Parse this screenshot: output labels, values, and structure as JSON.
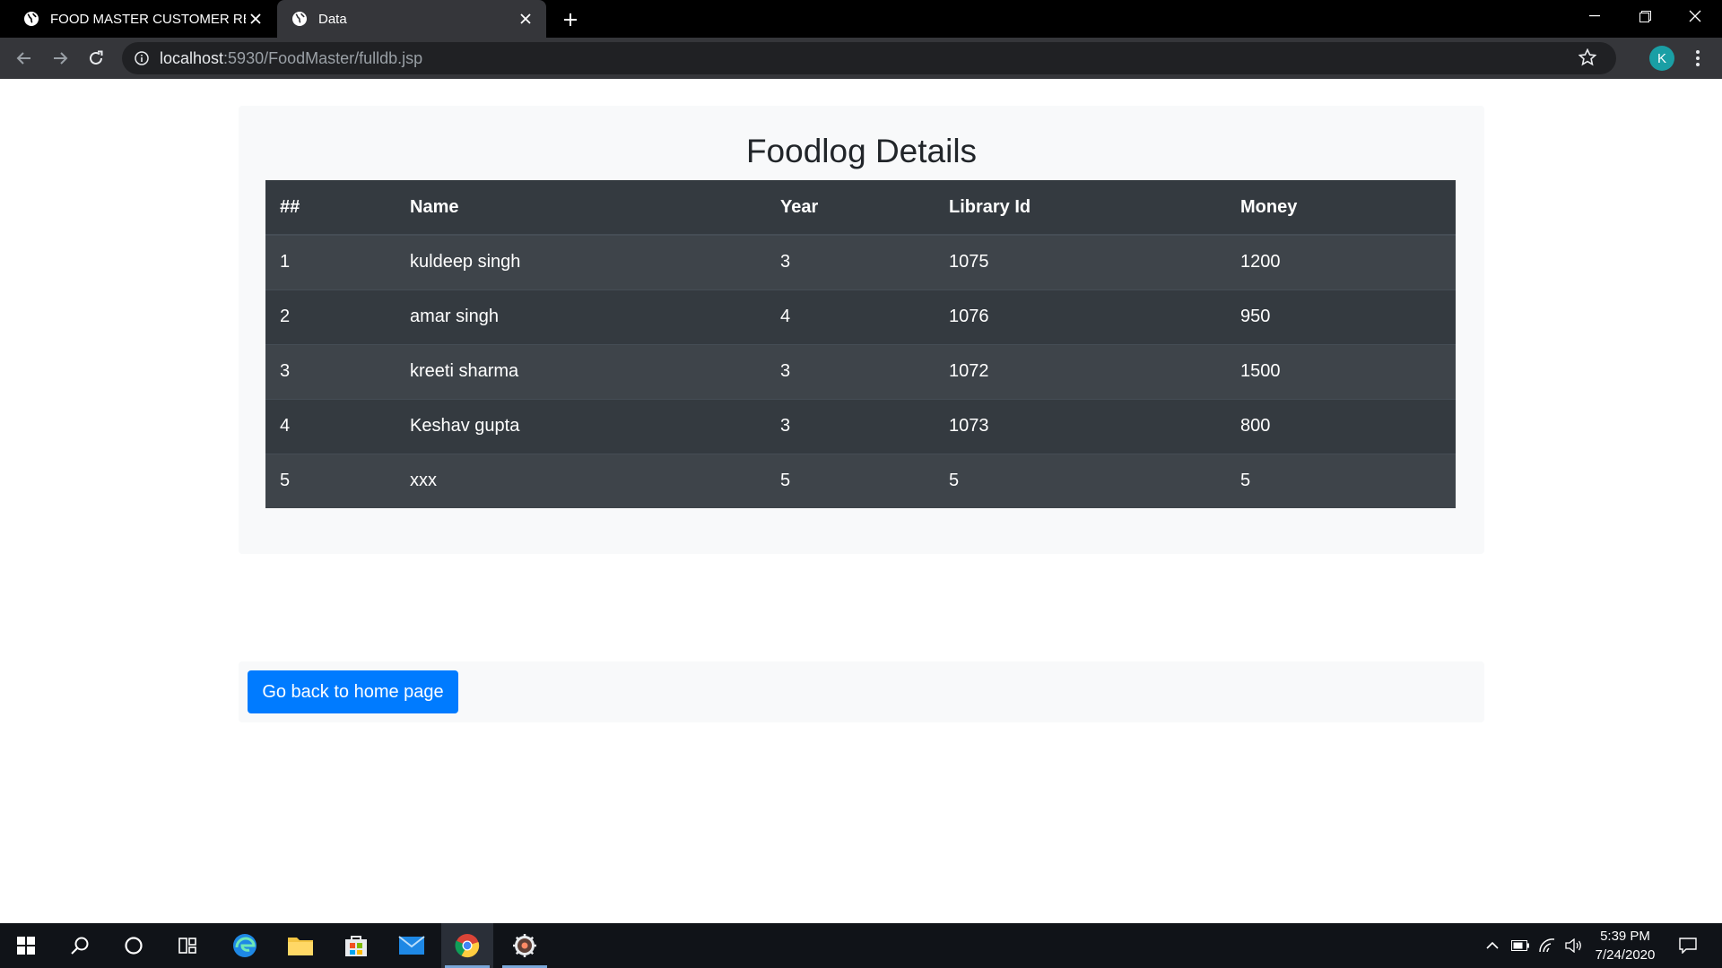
{
  "browser": {
    "tabs": [
      {
        "title": "FOOD MASTER CUSTOMER RECO",
        "icon": "globe-icon"
      },
      {
        "title": "Data",
        "icon": "globe-icon"
      }
    ],
    "url_host": "localhost",
    "url_rest": ":5930/FoodMaster/fulldb.jsp",
    "profile_initial": "K"
  },
  "page": {
    "heading": "Foodlog Details",
    "columns": [
      "##",
      "Name",
      "Year",
      "Library Id",
      "Money"
    ],
    "rows": [
      [
        "1",
        "kuldeep singh",
        "3",
        "1075",
        "1200"
      ],
      [
        "2",
        "amar singh",
        "4",
        "1076",
        "950"
      ],
      [
        "3",
        "kreeti sharma",
        "3",
        "1072",
        "1500"
      ],
      [
        "4",
        "Keshav gupta",
        "3",
        "1073",
        "800"
      ],
      [
        "5",
        "xxx",
        "5",
        "5",
        "5"
      ]
    ],
    "home_button": "Go back to home page"
  },
  "taskbar": {
    "time": "5:39 PM",
    "date": "7/24/2020"
  },
  "colors": {
    "button": "#007bff",
    "table_dark": "#343a40",
    "table_stripe": "#3e444a",
    "card_bg": "#f8f9fa",
    "avatar": "#1a9fa5"
  }
}
